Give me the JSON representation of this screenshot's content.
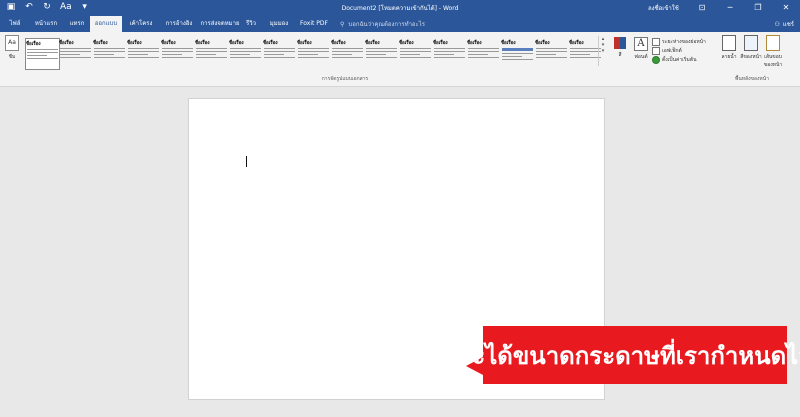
{
  "titlebar": {
    "title": "Document2 [โหมดความเข้ากันได้] - Word",
    "signin": "ลงชื่อเข้าใช้",
    "qat": {
      "save_icon": "save-icon",
      "undo_icon": "undo-icon",
      "redo_icon": "redo-icon",
      "format_label": "Aa",
      "customize_icon": "customize-qat-icon"
    },
    "controls": {
      "ribbon_display": "⊡",
      "minimize": "─",
      "restore": "❐",
      "close": "✕"
    }
  },
  "tabs": [
    "ไฟล์",
    "หน้าแรก",
    "แทรก",
    "ออกแบบ",
    "เค้าโครง",
    "การอ้างอิง",
    "การส่งจดหมาย",
    "รีวิว",
    "มุมมอง",
    "Foxit PDF"
  ],
  "active_tab": "ออกแบบ",
  "tellme": {
    "placeholder": "บอกฉันว่าคุณต้องการทำอะไร",
    "icon": "lightbulb-icon"
  },
  "share": {
    "label": "แชร์",
    "icon": "person-icon"
  },
  "ribbon": {
    "themes_label": "ชีม",
    "styles": [
      "ชื่อเรื่อง",
      "ชื่อเรื่อง",
      "ชื่อเรื่อง",
      "ชื่อเรื่อง",
      "ชื่อเรื่อง",
      "ชื่อเรื่อง",
      "ชื่อเรื่อง",
      "ชื่อเรื่อง",
      "ชื่อเรื่อง",
      "ชื่อเรื่อง",
      "ชื่อเรื่อง",
      "ชื่อเรื่อง",
      "ชื่อเรื่อง",
      "ชื่อเรื่อง",
      "ชื่อเรื่อง",
      "ชื่อเรื่อง",
      "ชื่อเรื่อง"
    ],
    "doc_format_group": "การจัดรูปแบบเอกสาร",
    "colors_label": "สี",
    "fonts_label": "ฟอนต์",
    "paragraph_spacing": "ระยะห่างของย่อหน้า",
    "effects": "เอฟเฟ็กต์",
    "set_default": "ตั้งเป็นค่าเริ่มต้น",
    "page_background_group": "พื้นหลังของหน้า",
    "watermark": "ลายน้ำ",
    "page_color": "สีของหน้า",
    "page_borders": "เส้นขอบของหน้า"
  },
  "callout": {
    "text": "จะได้ขนาดกระดาษที่เรากำหนดไว้"
  }
}
